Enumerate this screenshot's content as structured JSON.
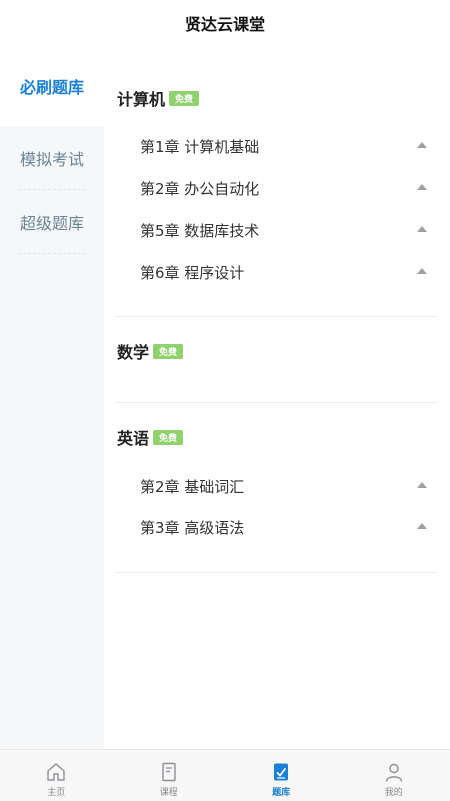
{
  "app_title": "贤达云课堂",
  "sidebar": {
    "items": [
      {
        "label": "必刷题库",
        "active": true
      },
      {
        "label": "模拟考试",
        "active": false
      },
      {
        "label": "超级题库",
        "active": false
      }
    ]
  },
  "subjects": [
    {
      "title": "计算机",
      "badge": "免费",
      "chapters": [
        "第1章 计算机基础",
        "第2章 办公自动化",
        "第5章 数据库技术",
        "第6章 程序设计"
      ]
    },
    {
      "title": "数学",
      "badge": "免费",
      "chapters": []
    },
    {
      "title": "英语",
      "badge": "免费",
      "chapters": [
        "第2章 基础词汇",
        "第3章 高级语法"
      ]
    }
  ],
  "tabbar": {
    "items": [
      {
        "label": "主页",
        "icon": "home-icon",
        "active": false
      },
      {
        "label": "课程",
        "icon": "course-icon",
        "active": false
      },
      {
        "label": "题库",
        "icon": "question-bank-icon",
        "active": true
      },
      {
        "label": "我的",
        "icon": "profile-icon",
        "active": false
      }
    ]
  },
  "colors": {
    "accent": "#1a7fd6",
    "badge": "#8fd16b",
    "sidebar_bg": "#f6f7f9"
  }
}
